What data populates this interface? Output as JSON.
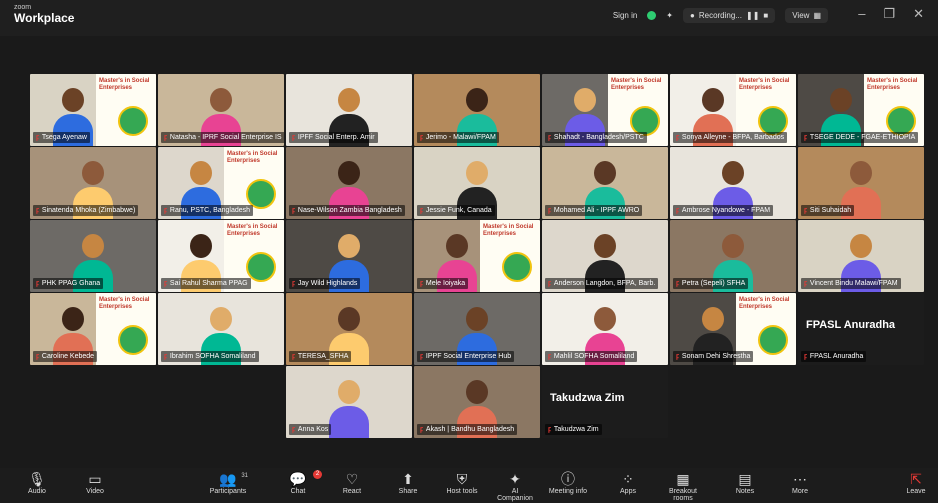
{
  "window": {
    "brand_small": "zoom",
    "brand": "Workplace"
  },
  "topbar": {
    "signin": "Sign in",
    "recording": "Recording...",
    "view": "View"
  },
  "tiles": [
    {
      "name": "Tsega Ayenaw",
      "poster": true
    },
    {
      "name": "Natasha - IPRF Social Enterprise IS",
      "poster": false
    },
    {
      "name": "IPFF Social Enterp. Amir",
      "poster": false
    },
    {
      "name": "Jerimo - Malawi/FPAM",
      "poster": false
    },
    {
      "name": "Shahadt - Bangladesh/PSTC",
      "poster": true
    },
    {
      "name": "Sonya Alleyne - BFPA, Barbados",
      "poster": true
    },
    {
      "name": "TSEGE DEDE - FGAE-ETHIOPIA",
      "poster": true
    },
    {
      "name": "Sinatenda Mhoka (Zimbabwe)",
      "poster": false
    },
    {
      "name": "Ranu, PSTC, Bangladesh",
      "poster": true
    },
    {
      "name": "Nase-Wilson Zambia Bangladesh",
      "poster": false
    },
    {
      "name": "Jessie Funk, Canada",
      "poster": false
    },
    {
      "name": "Mohamed Ali - IPPF AWRO",
      "poster": false
    },
    {
      "name": "Ambrose Nyandowe - FPAM",
      "poster": false
    },
    {
      "name": "Siti Suhaidah",
      "poster": false
    },
    {
      "name": "PHK PPAG Ghana",
      "poster": false
    },
    {
      "name": "Sai Rahul Sharma PPAG",
      "poster": true
    },
    {
      "name": "Jay Wild Highlands",
      "poster": false
    },
    {
      "name": "Mele Ioiyaka",
      "poster": true
    },
    {
      "name": "Anderson Langdon, BFPA, Barb.",
      "poster": false
    },
    {
      "name": "Petra (Sepeli) SFHA",
      "poster": false
    },
    {
      "name": "Vincent Bindu Malawi/FPAM",
      "poster": false
    },
    {
      "name": "Caroline Kebede",
      "poster": true
    },
    {
      "name": "Ibrahim SOFHA Somaliland",
      "poster": false
    },
    {
      "name": "TERESA_SFHA",
      "poster": false
    },
    {
      "name": "IPPF Social Enterprise Hub",
      "poster": false
    },
    {
      "name": "Mahlil SOFHA Somaliland",
      "poster": false
    },
    {
      "name": "Sonam Dehi Shrestha",
      "poster": true
    },
    {
      "name": "FPASL Anuradha",
      "poster": false,
      "label": "FPASL Anuradha"
    },
    {
      "name": "Anna Kos",
      "poster": false
    },
    {
      "name": "Akash | Bandhu Bangladesh",
      "poster": false
    },
    {
      "name": "Takudzwa Zim",
      "poster": false,
      "label": "Takudzwa Zim"
    }
  ],
  "poster": {
    "title": "Master's in Social Enterprises"
  },
  "toolbar": [
    {
      "label": "Audio",
      "icon": "mic-icon",
      "glyph": "🎙"
    },
    {
      "label": "Video",
      "icon": "camera-icon",
      "glyph": "▭"
    },
    {
      "label": "Participants",
      "icon": "participants-icon",
      "glyph": "👥",
      "count": "31"
    },
    {
      "label": "Chat",
      "icon": "chat-icon",
      "glyph": "💬",
      "badge": "2"
    },
    {
      "label": "React",
      "icon": "heart-icon",
      "glyph": "♡"
    },
    {
      "label": "Share",
      "icon": "share-icon",
      "glyph": "⬆"
    },
    {
      "label": "Host tools",
      "icon": "shield-icon",
      "glyph": "⛨"
    },
    {
      "label": "AI Companion",
      "icon": "sparkle-icon",
      "glyph": "✦"
    },
    {
      "label": "Meeting info",
      "icon": "info-icon",
      "glyph": "ⓘ"
    },
    {
      "label": "Apps",
      "icon": "apps-icon",
      "glyph": "⁘"
    },
    {
      "label": "Breakout rooms",
      "icon": "grid-icon",
      "glyph": "▦"
    },
    {
      "label": "Notes",
      "icon": "notes-icon",
      "glyph": "▤"
    },
    {
      "label": "More",
      "icon": "more-icon",
      "glyph": "⋯"
    },
    {
      "label": "Leave",
      "icon": "leave-icon",
      "glyph": "⇱"
    }
  ]
}
